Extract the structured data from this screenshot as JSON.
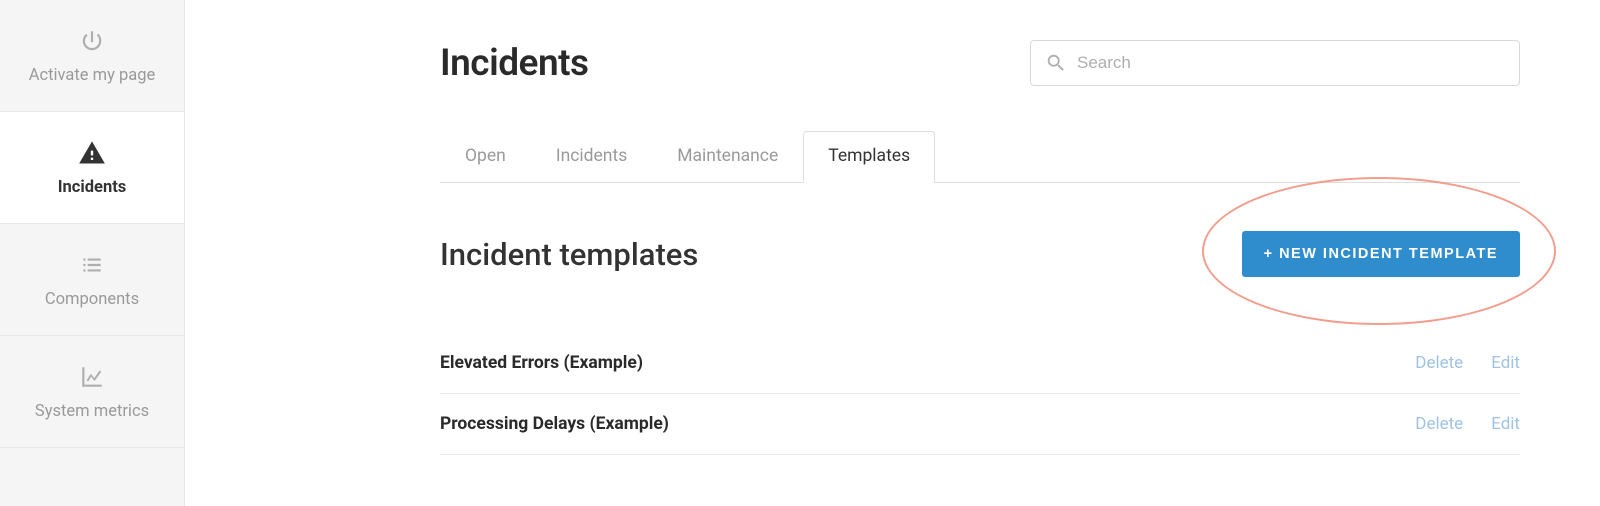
{
  "sidebar": {
    "items": [
      {
        "label": "Activate my page",
        "icon": "power",
        "active": false
      },
      {
        "label": "Incidents",
        "icon": "warning",
        "active": true
      },
      {
        "label": "Components",
        "icon": "list",
        "active": false
      },
      {
        "label": "System metrics",
        "icon": "chart",
        "active": false
      }
    ]
  },
  "header": {
    "title": "Incidents",
    "search_placeholder": "Search"
  },
  "tabs": [
    {
      "label": "Open",
      "active": false
    },
    {
      "label": "Incidents",
      "active": false
    },
    {
      "label": "Maintenance",
      "active": false
    },
    {
      "label": "Templates",
      "active": true
    }
  ],
  "section": {
    "title": "Incident templates",
    "new_button": "+ NEW INCIDENT TEMPLATE"
  },
  "templates": [
    {
      "name": "Elevated Errors (Example)",
      "delete": "Delete",
      "edit": "Edit"
    },
    {
      "name": "Processing Delays (Example)",
      "delete": "Delete",
      "edit": "Edit"
    }
  ],
  "colors": {
    "primary_button": "#2f8dce",
    "annotation": "#f29e8e",
    "link": "#9fc3e0"
  }
}
